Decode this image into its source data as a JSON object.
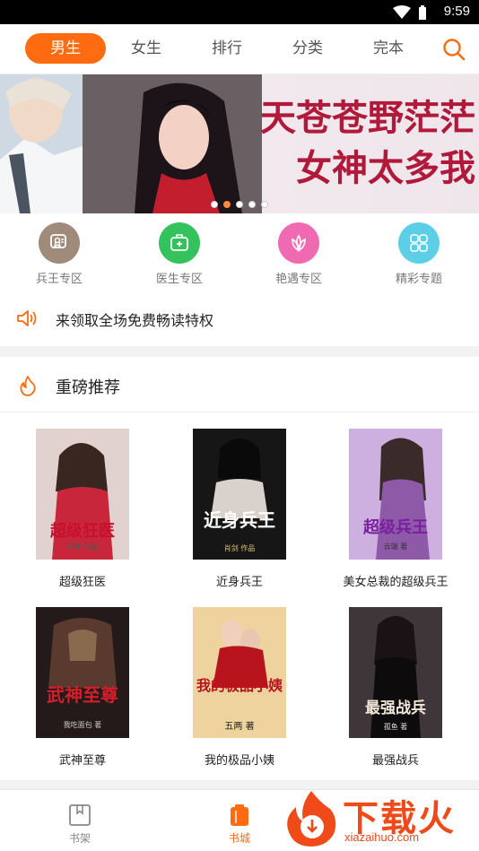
{
  "status": {
    "time": "9:59"
  },
  "nav": {
    "tabs": [
      {
        "label": "男生"
      },
      {
        "label": "女生"
      },
      {
        "label": "排行"
      },
      {
        "label": "分类"
      },
      {
        "label": "完本"
      }
    ]
  },
  "banner": {
    "headline_1": "天苍苍野茫茫",
    "headline_2": "女神太多我",
    "slides": 5,
    "active_slide": 2
  },
  "zones": [
    {
      "label": "兵王专区",
      "color": "#a08a7a",
      "icon": "medal-icon"
    },
    {
      "label": "医生专区",
      "color": "#34c25c",
      "icon": "medkit-icon"
    },
    {
      "label": "艳遇专区",
      "color": "#f06ab2",
      "icon": "lotus-icon"
    },
    {
      "label": "精彩专题",
      "color": "#5ccfe6",
      "icon": "grid-icon"
    }
  ],
  "notice": {
    "text": "来领取全场免费畅读特权"
  },
  "section": {
    "title": "重磅推荐"
  },
  "books": [
    {
      "name": "超级狂医",
      "cover_title": "超级狂医",
      "cover_author": "月神 作品",
      "bg": "#d7c4c0"
    },
    {
      "name": "近身兵王",
      "cover_title": "近身兵王",
      "cover_author": "肖剑 作品",
      "bg": "#1a1a1a"
    },
    {
      "name": "美女总裁的超级兵王",
      "cover_title": "超级兵王",
      "cover_author": "云端 著",
      "bg": "#c7a6dc"
    },
    {
      "name": "武神至尊",
      "cover_title": "武神至尊",
      "cover_author": "我吃面包 著",
      "bg": "#2b1f1f"
    },
    {
      "name": "我的极品小姨",
      "cover_title": "我的极品小姨",
      "cover_author": "五两 著",
      "bg": "#e8c890"
    },
    {
      "name": "最强战兵",
      "cover_title": "最强战兵",
      "cover_author": "孤鱼 著",
      "bg": "#4a4245"
    }
  ],
  "bottom": {
    "shelf_label": "书架",
    "store_label": "书城"
  },
  "watermark": {
    "big": "下载火",
    "small": "xiazaihuo.com"
  },
  "colors": {
    "accent": "#ff6b10"
  }
}
